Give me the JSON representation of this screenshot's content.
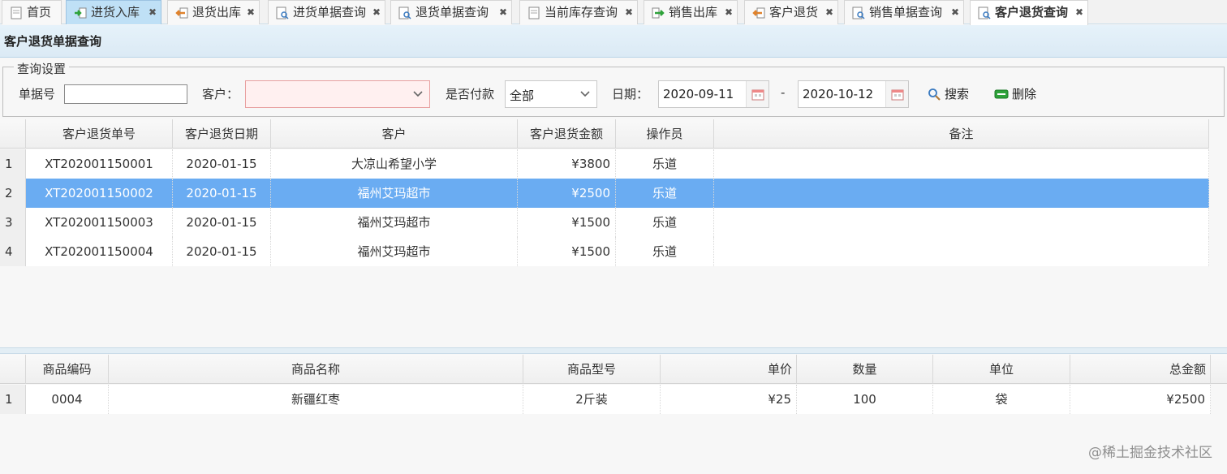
{
  "tabs": [
    {
      "label": "首页",
      "icon": "page-icon",
      "closable": false
    },
    {
      "label": "进货入库",
      "icon": "arrow-in-icon",
      "closable": true
    },
    {
      "label": "退货出库",
      "icon": "arrow-back-icon",
      "closable": true
    },
    {
      "label": "进货单据查询",
      "icon": "doc-search-icon",
      "closable": true
    },
    {
      "label": "退货单据查询",
      "icon": "doc-search-icon",
      "closable": true
    },
    {
      "label": "当前库存查询",
      "icon": "page-icon",
      "closable": true
    },
    {
      "label": "销售出库",
      "icon": "arrow-out-icon",
      "closable": true
    },
    {
      "label": "客户退货",
      "icon": "arrow-back-icon",
      "closable": true
    },
    {
      "label": "销售单据查询",
      "icon": "doc-search-icon",
      "closable": true
    },
    {
      "label": "客户退货查询",
      "icon": "doc-search-icon",
      "closable": true
    }
  ],
  "close_glyph": "✖",
  "panel_title": "客户退货单据查询",
  "query": {
    "legend": "查询设置",
    "bill_no_label": "单据号",
    "bill_no_value": "",
    "customer_label": "客户：",
    "customer_value": "",
    "paid_label": "是否付款",
    "paid_value": "全部",
    "date_label": "日期：",
    "date_from": "2020-09-11",
    "date_sep": "-",
    "date_to": "2020-10-12",
    "search_label": "搜索",
    "delete_label": "删除"
  },
  "colors": {
    "selected_row": "#6aacf2",
    "customer_box_invalid": "#fff0f0",
    "delete_icon": "#2ea23a"
  },
  "main_grid": {
    "columns": [
      "客户退货单号",
      "客户退货日期",
      "客户",
      "客户退货金额",
      "操作员",
      "备注"
    ],
    "selected_row": 2,
    "rows": [
      {
        "n": "1",
        "no": "XT202001150001",
        "date": "2020-01-15",
        "customer": "大凉山希望小学",
        "amount": "¥3800",
        "operator": "乐道",
        "remark": ""
      },
      {
        "n": "2",
        "no": "XT202001150002",
        "date": "2020-01-15",
        "customer": "福州艾玛超市",
        "amount": "¥2500",
        "operator": "乐道",
        "remark": ""
      },
      {
        "n": "3",
        "no": "XT202001150003",
        "date": "2020-01-15",
        "customer": "福州艾玛超市",
        "amount": "¥1500",
        "operator": "乐道",
        "remark": ""
      },
      {
        "n": "4",
        "no": "XT202001150004",
        "date": "2020-01-15",
        "customer": "福州艾玛超市",
        "amount": "¥1500",
        "operator": "乐道",
        "remark": ""
      }
    ]
  },
  "detail_grid": {
    "columns": [
      "商品编码",
      "商品名称",
      "商品型号",
      "单价",
      "数量",
      "单位",
      "总金额"
    ],
    "rows": [
      {
        "n": "1",
        "code": "0004",
        "name": "新疆红枣",
        "model": "2斤装",
        "price": "¥25",
        "qty": "100",
        "unit": "袋",
        "total": "¥2500"
      }
    ]
  },
  "watermark": "@稀土掘金技术社区"
}
